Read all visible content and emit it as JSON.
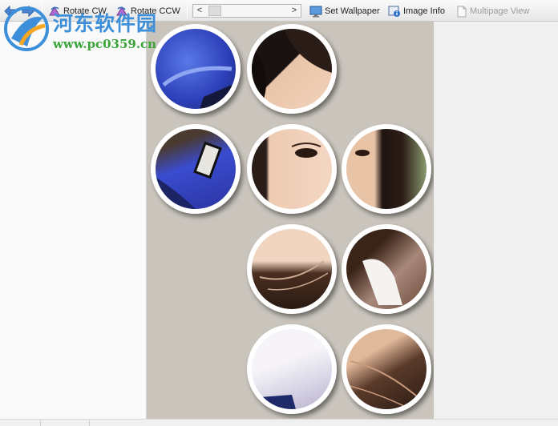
{
  "toolbar": {
    "rotate_cw_label": "Rotate CW",
    "rotate_ccw_label": "Rotate CCW",
    "scroll_left_glyph": "<",
    "scroll_right_glyph": ">",
    "set_wallpaper_label": "Set Wallpaper",
    "image_info_label": "Image Info",
    "multipage_view_label": "Multipage View"
  },
  "watermark": {
    "site_name": "河东软件园",
    "url": "www.pc0359.cn"
  },
  "viewer": {
    "image_icons": [
      "circle-photo",
      "circle-photo",
      "circle-photo",
      "circle-photo",
      "circle-photo",
      "circle-photo",
      "circle-photo",
      "circle-photo",
      "circle-photo"
    ]
  },
  "colors": {
    "viewer_background": "#c9c4bc",
    "logo_blue": "#3c8fd8",
    "logo_green": "#3aa33a"
  }
}
